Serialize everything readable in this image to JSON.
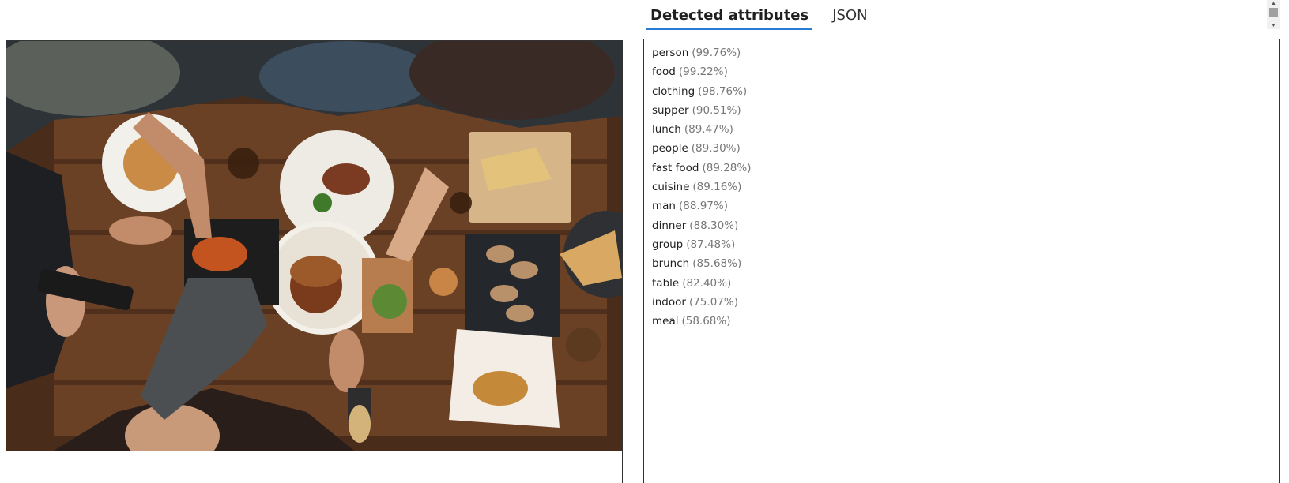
{
  "tabs": [
    {
      "label": "Detected attributes",
      "active": true
    },
    {
      "label": "JSON",
      "active": false
    }
  ],
  "attributes": [
    {
      "name": "person",
      "confidence": "(99.76%)"
    },
    {
      "name": "food",
      "confidence": "(99.22%)"
    },
    {
      "name": "clothing",
      "confidence": "(98.76%)"
    },
    {
      "name": "supper",
      "confidence": "(90.51%)"
    },
    {
      "name": "lunch",
      "confidence": "(89.47%)"
    },
    {
      "name": "people",
      "confidence": "(89.30%)"
    },
    {
      "name": "fast food",
      "confidence": "(89.28%)"
    },
    {
      "name": "cuisine",
      "confidence": "(89.16%)"
    },
    {
      "name": "man",
      "confidence": "(88.97%)"
    },
    {
      "name": "dinner",
      "confidence": "(88.30%)"
    },
    {
      "name": "group",
      "confidence": "(87.48%)"
    },
    {
      "name": "brunch",
      "confidence": "(85.68%)"
    },
    {
      "name": "table",
      "confidence": "(82.40%)"
    },
    {
      "name": "indoor",
      "confidence": "(75.07%)"
    },
    {
      "name": "meal",
      "confidence": "(58.68%)"
    }
  ],
  "colors": {
    "accent": "#2a7bd4",
    "table_wood": "#5a3520",
    "confidence_text": "#777777"
  }
}
